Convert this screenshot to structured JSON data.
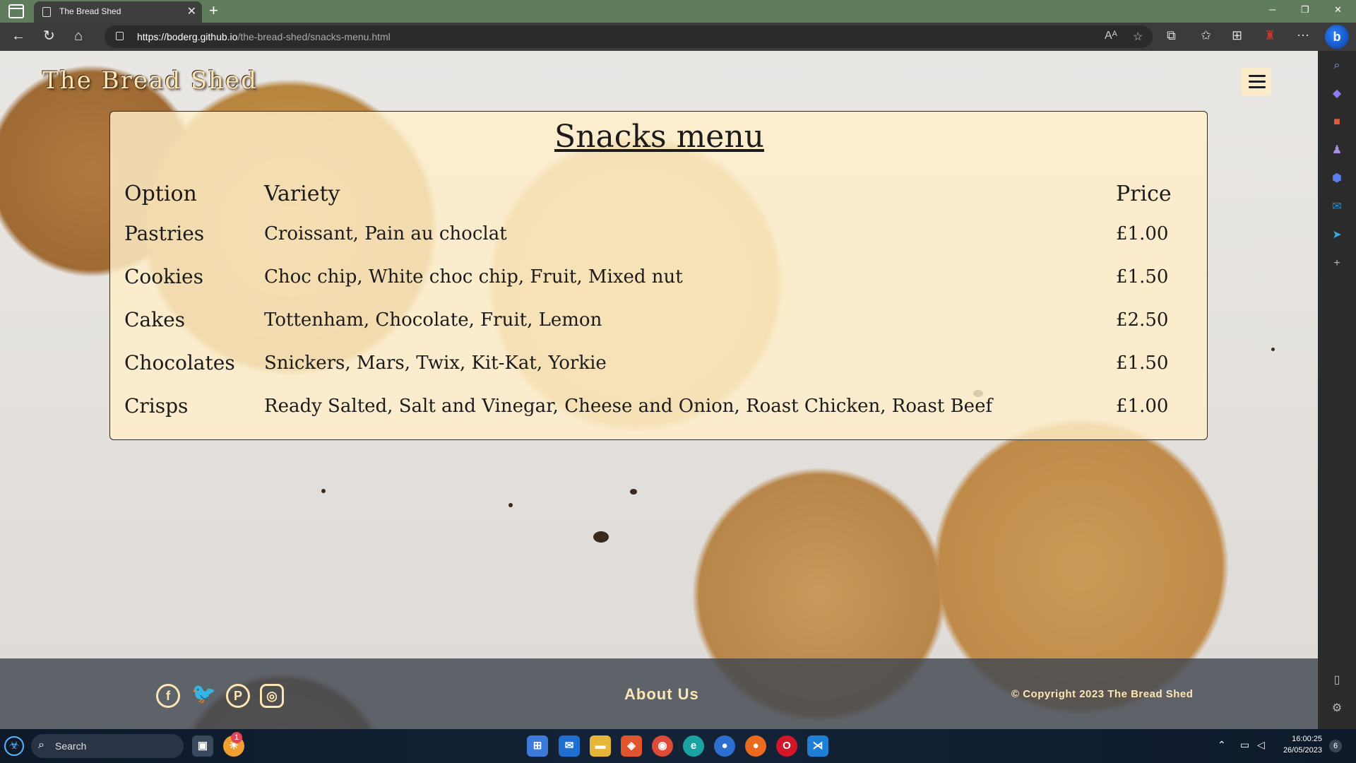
{
  "browser": {
    "tab_title": "The Bread Shed",
    "url_domain": "https://boderg.github.io",
    "url_path": "/the-bread-shed/snacks-menu.html"
  },
  "site": {
    "title": "The Bread Shed"
  },
  "menu": {
    "heading": "Snacks menu",
    "columns": [
      "Option",
      "Variety",
      "Price"
    ],
    "rows": [
      {
        "option": "Pastries",
        "variety": "Croissant, Pain au choclat",
        "price": "£1.00"
      },
      {
        "option": "Cookies",
        "variety": "Choc chip, White choc chip, Fruit, Mixed nut",
        "price": "£1.50"
      },
      {
        "option": "Cakes",
        "variety": "Tottenham, Chocolate, Fruit, Lemon",
        "price": "£2.50"
      },
      {
        "option": "Chocolates",
        "variety": "Snickers, Mars, Twix, Kit-Kat, Yorkie",
        "price": "£1.50"
      },
      {
        "option": "Crisps",
        "variety": "Ready Salted, Salt and Vinegar, Cheese and Onion, Roast Chicken, Roast Beef",
        "price": "£1.00"
      }
    ]
  },
  "footer": {
    "about_label": "About Us",
    "copyright": "© Copyright 2023 The Bread Shed",
    "social": [
      "facebook-icon",
      "twitter-icon",
      "pinterest-icon",
      "instagram-icon"
    ]
  },
  "taskbar": {
    "search_label": "Search",
    "time": "16:00:25",
    "date": "26/05/2023",
    "notification_count": "1",
    "badge_count": "6"
  },
  "colors": {
    "accent": "#fde5b4",
    "card": "#ffeec8",
    "footer": "#424850",
    "tabbar": "#5f7d5c"
  }
}
